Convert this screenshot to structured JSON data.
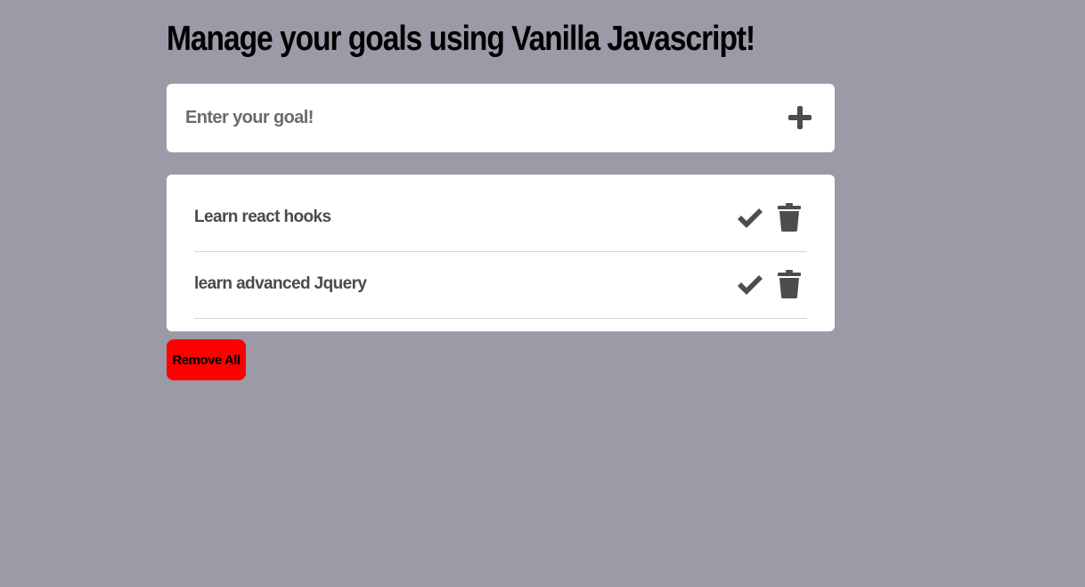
{
  "header": {
    "title": "Manage your goals using Vanilla Javascript!"
  },
  "goal_form": {
    "input_value": "",
    "input_placeholder": "Enter your goal!",
    "add_icon": "plus-icon"
  },
  "goals": [
    {
      "text": "Learn react hooks",
      "complete_icon": "check-icon",
      "delete_icon": "trash-icon"
    },
    {
      "text": "learn advanced Jquery",
      "complete_icon": "check-icon",
      "delete_icon": "trash-icon"
    }
  ],
  "actions": {
    "remove_all_label": "Remove All"
  },
  "colors": {
    "background": "#9c9aa7",
    "card": "#ffffff",
    "icon": "#4d4d4d",
    "danger": "#ff0000"
  }
}
